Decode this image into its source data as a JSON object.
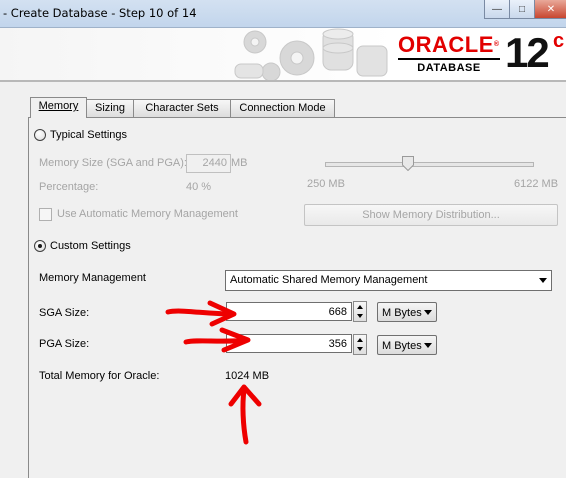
{
  "window": {
    "title": "- Create Database - Step 10 of 14",
    "controls": {
      "minimize_icon": "minimize-icon",
      "maximize_icon": "maximize-icon",
      "close_icon": "close-icon"
    }
  },
  "header": {
    "logo_text": "ORACLE",
    "logo_sub": "DATABASE",
    "version": "12",
    "version_suffix": "c",
    "brand_color": "#e20000"
  },
  "tabs": [
    {
      "label": "Memory",
      "mnemonic": "M",
      "active": true
    },
    {
      "label": "Sizing",
      "mnemonic": "S",
      "active": false
    },
    {
      "label": "Character Sets",
      "mnemonic": "C",
      "active": false
    },
    {
      "label": "Connection Mode",
      "mnemonic": "o",
      "active": false
    }
  ],
  "typical": {
    "radio_label": "Typical Settings",
    "selected": false,
    "memory_size_label": "Memory Size (SGA and PGA):",
    "memory_size_value": "2440",
    "memory_size_unit": "MB",
    "percentage_label": "Percentage:",
    "percentage_value": "40 %",
    "slider_min": "250 MB",
    "slider_max": "6122 MB",
    "slider_fraction": 0.4,
    "amm_label": "Use Automatic Memory Management",
    "amm_checked": false,
    "show_distribution_label": "Show Memory Distribution..."
  },
  "custom": {
    "radio_label": "Custom Settings",
    "selected": true,
    "memory_management_label": "Memory Management",
    "memory_management_value": "Automatic Shared Memory Management",
    "sga_label": "SGA Size:",
    "sga_value": "668",
    "sga_unit": "M Bytes",
    "pga_label": "PGA Size:",
    "pga_value": "356",
    "pga_unit": "M Bytes",
    "total_label": "Total Memory for Oracle:",
    "total_value": "1024 MB"
  },
  "annotations": {
    "color": "#ee0000",
    "arrows": [
      "arrow-to-sga",
      "arrow-to-pga",
      "arrow-to-total"
    ]
  }
}
